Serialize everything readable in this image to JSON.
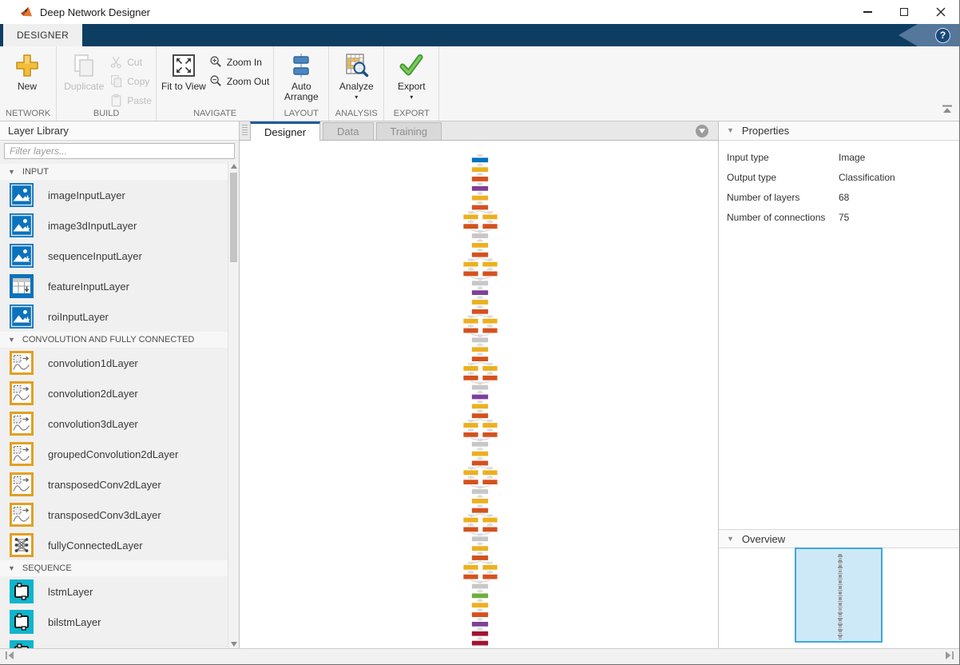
{
  "window": {
    "title": "Deep Network Designer"
  },
  "ribbon": {
    "tab_label": "DESIGNER",
    "help_label": "?",
    "groups": [
      {
        "label": "NETWORK",
        "items": [
          {
            "label": "New",
            "icon": "new",
            "enabled": true,
            "size": "big",
            "dropdown": false
          }
        ]
      },
      {
        "label": "BUILD",
        "items": [
          {
            "label": "Duplicate",
            "icon": "duplicate",
            "enabled": false,
            "size": "big",
            "dropdown": false
          },
          {
            "label": "Cut",
            "icon": "cut",
            "enabled": false,
            "size": "small"
          },
          {
            "label": "Copy",
            "icon": "copy",
            "enabled": false,
            "size": "small"
          },
          {
            "label": "Paste",
            "icon": "paste",
            "enabled": false,
            "size": "small"
          }
        ]
      },
      {
        "label": "NAVIGATE",
        "items": [
          {
            "label": "Fit to View",
            "icon": "fit",
            "enabled": true,
            "size": "big",
            "dropdown": false
          },
          {
            "label": "Zoom In",
            "icon": "zoom-in",
            "enabled": true,
            "size": "small"
          },
          {
            "label": "Zoom Out",
            "icon": "zoom-out",
            "enabled": true,
            "size": "small"
          }
        ]
      },
      {
        "label": "LAYOUT",
        "items": [
          {
            "label": "Auto Arrange",
            "icon": "auto-arrange",
            "enabled": true,
            "size": "big",
            "dropdown": false
          }
        ]
      },
      {
        "label": "ANALYSIS",
        "items": [
          {
            "label": "Analyze",
            "icon": "analyze",
            "enabled": true,
            "size": "big",
            "dropdown": true
          }
        ]
      },
      {
        "label": "EXPORT",
        "items": [
          {
            "label": "Export",
            "icon": "export",
            "enabled": true,
            "size": "big",
            "dropdown": true
          }
        ]
      }
    ]
  },
  "layer_library": {
    "title": "Layer Library",
    "filter_placeholder": "Filter layers...",
    "sections": [
      {
        "label": "INPUT",
        "items": [
          {
            "label": "imageInputLayer",
            "icon": "input"
          },
          {
            "label": "image3dInputLayer",
            "icon": "input"
          },
          {
            "label": "sequenceInputLayer",
            "icon": "input"
          },
          {
            "label": "featureInputLayer",
            "icon": "feature"
          },
          {
            "label": "roiInputLayer",
            "icon": "input"
          }
        ]
      },
      {
        "label": "CONVOLUTION AND FULLY CONNECTED",
        "items": [
          {
            "label": "convolution1dLayer",
            "icon": "conv"
          },
          {
            "label": "convolution2dLayer",
            "icon": "conv"
          },
          {
            "label": "convolution3dLayer",
            "icon": "conv"
          },
          {
            "label": "groupedConvolution2dLayer",
            "icon": "conv"
          },
          {
            "label": "transposedConv2dLayer",
            "icon": "conv"
          },
          {
            "label": "transposedConv3dLayer",
            "icon": "conv"
          },
          {
            "label": "fullyConnectedLayer",
            "icon": "fc"
          }
        ]
      },
      {
        "label": "SEQUENCE",
        "items": [
          {
            "label": "lstmLayer",
            "icon": "seq"
          },
          {
            "label": "bilstmLayer",
            "icon": "seq"
          },
          {
            "label": "",
            "icon": "seq"
          }
        ]
      }
    ]
  },
  "document_tabs": [
    {
      "label": "Designer",
      "active": true
    },
    {
      "label": "Data",
      "active": false
    },
    {
      "label": "Training",
      "active": false
    }
  ],
  "properties": {
    "title": "Properties",
    "rows": [
      {
        "label": "Input type",
        "value": "Image"
      },
      {
        "label": "Output type",
        "value": "Classification"
      },
      {
        "label": "Number of layers",
        "value": "68"
      },
      {
        "label": "Number of connections",
        "value": "75"
      }
    ]
  },
  "overview": {
    "title": "Overview"
  },
  "network": {
    "palette": {
      "blue": "#0072BD",
      "yellow": "#ECB01F",
      "orange": "#D4511E",
      "purple": "#7E3F98",
      "gray": "#C7C7C7",
      "green": "#6DAE3C",
      "crimson": "#A2142F"
    },
    "rows": [
      "blue",
      "yellow",
      "orange",
      "purple",
      "yellow",
      "orange",
      "yellow2",
      "orange2",
      "gray",
      "yellow",
      "orange",
      "yellow2",
      "orange2",
      "gray",
      "purple",
      "yellow",
      "orange",
      "yellow2",
      "orange2",
      "gray",
      "yellow",
      "orange",
      "yellow2",
      "orange2",
      "gray",
      "purple",
      "yellow",
      "orange",
      "yellow2",
      "orange2",
      "gray",
      "yellow",
      "orange",
      "yellow2",
      "orange2",
      "gray",
      "yellow",
      "orange",
      "yellow2",
      "orange2",
      "gray",
      "yellow",
      "orange",
      "yellow2",
      "orange2",
      "gray",
      "green",
      "yellow",
      "orange",
      "purple",
      "crimson",
      "crimson"
    ]
  }
}
